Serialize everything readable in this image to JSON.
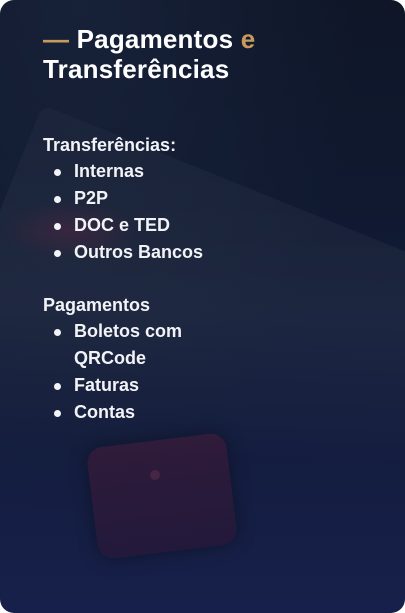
{
  "card": {
    "title_dash": "—",
    "title_line1": "Pagamentos",
    "title_accent": "e",
    "title_line2": "Transferências",
    "accent_color": "#c99a5d"
  },
  "sections": [
    {
      "heading": "Transferências:",
      "items": [
        "Internas",
        "P2P",
        "DOC e TED",
        "Outros Bancos"
      ]
    },
    {
      "heading": "Pagamentos",
      "items": [
        "Boletos com QRCode",
        "Faturas",
        "Contas"
      ]
    }
  ]
}
